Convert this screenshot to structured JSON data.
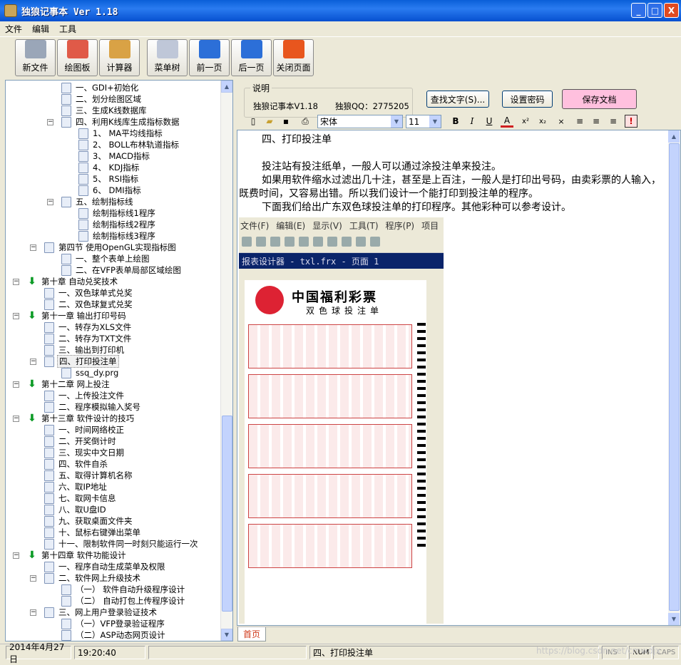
{
  "window": {
    "title": "独狼记事本 Ver 1.18",
    "controls": [
      "_",
      "□",
      "X"
    ]
  },
  "menu": [
    "文件",
    "编辑",
    "工具"
  ],
  "toolbar": [
    {
      "label": "新文件",
      "icon": "new-file-icon",
      "color": "#9aa6b8"
    },
    {
      "label": "绘图板",
      "icon": "paint-board-icon",
      "color": "#e05a48"
    },
    {
      "label": "计算器",
      "icon": "calculator-icon",
      "color": "#d9a245"
    },
    {
      "label": "菜单树",
      "icon": "menu-tree-icon",
      "color": "#bfc7d8"
    },
    {
      "label": "前一页",
      "icon": "arrow-left-icon",
      "color": "#2c6fd8"
    },
    {
      "label": "后一页",
      "icon": "arrow-right-icon",
      "color": "#2c6fd8"
    },
    {
      "label": "关闭页面",
      "icon": "close-page-icon",
      "color": "#e8561e"
    }
  ],
  "tree": [
    {
      "text": "一、GDI+初始化",
      "level": 4,
      "type": "doc"
    },
    {
      "text": "二、划分绘图区域",
      "level": 4,
      "type": "doc"
    },
    {
      "text": "三、生成K线数据库",
      "level": 4,
      "type": "doc"
    },
    {
      "text": "四、利用K线库生成指标数据",
      "level": 4,
      "type": "doc",
      "expanded": true
    },
    {
      "text": "1、 MA平均线指标",
      "level": 5,
      "type": "doc"
    },
    {
      "text": "2、 BOLL布林轨道指标",
      "level": 5,
      "type": "doc"
    },
    {
      "text": "3、 MACD指标",
      "level": 5,
      "type": "doc"
    },
    {
      "text": "4、 KDJ指标",
      "level": 5,
      "type": "doc"
    },
    {
      "text": "5、 RSI指标",
      "level": 5,
      "type": "doc"
    },
    {
      "text": "6、 DMI指标",
      "level": 5,
      "type": "doc"
    },
    {
      "text": "五、绘制指标线",
      "level": 4,
      "type": "doc",
      "expanded": true
    },
    {
      "text": "绘制指标线1程序",
      "level": 5,
      "type": "doc"
    },
    {
      "text": "绘制指标线2程序",
      "level": 5,
      "type": "doc"
    },
    {
      "text": "绘制指标线3程序",
      "level": 5,
      "type": "doc"
    },
    {
      "text": "第四节 使用OpenGL实现指标图",
      "level": 2,
      "type": "doc",
      "expanded": true
    },
    {
      "text": "一、整个表单上绘图",
      "level": 3,
      "type": "doc"
    },
    {
      "text": "二、在VFP表单局部区域绘图",
      "level": 3,
      "type": "doc"
    },
    {
      "text": "第十章 自动兑奖技术",
      "level": 1,
      "type": "chapter",
      "expanded": true
    },
    {
      "text": "一、双色球单式兑奖",
      "level": 2,
      "type": "doc"
    },
    {
      "text": "二、双色球复式兑奖",
      "level": 2,
      "type": "doc"
    },
    {
      "text": "第十一章 输出打印号码",
      "level": 1,
      "type": "chapter",
      "expanded": true
    },
    {
      "text": "一、转存为XLS文件",
      "level": 2,
      "type": "doc"
    },
    {
      "text": "二、转存为TXT文件",
      "level": 2,
      "type": "doc"
    },
    {
      "text": "三、输出到打印机",
      "level": 2,
      "type": "doc"
    },
    {
      "text": "四、打印投注单",
      "level": 2,
      "type": "doc",
      "expanded": true,
      "selected": true
    },
    {
      "text": "ssq_dy.prg",
      "level": 3,
      "type": "doc"
    },
    {
      "text": "第十二章 网上投注",
      "level": 1,
      "type": "chapter",
      "expanded": true
    },
    {
      "text": "一、上传投注文件",
      "level": 2,
      "type": "doc"
    },
    {
      "text": "二、程序模拟输入奖号",
      "level": 2,
      "type": "doc"
    },
    {
      "text": "第十三章 软件设计的技巧",
      "level": 1,
      "type": "chapter",
      "expanded": true
    },
    {
      "text": "一、时间网络校正",
      "level": 2,
      "type": "doc"
    },
    {
      "text": "二、开奖倒计时",
      "level": 2,
      "type": "doc"
    },
    {
      "text": "三、现实中文日期",
      "level": 2,
      "type": "doc"
    },
    {
      "text": "四、软件自杀",
      "level": 2,
      "type": "doc"
    },
    {
      "text": "五、取得计算机名称",
      "level": 2,
      "type": "doc"
    },
    {
      "text": "六、取IP地址",
      "level": 2,
      "type": "doc"
    },
    {
      "text": "七、取网卡信息",
      "level": 2,
      "type": "doc"
    },
    {
      "text": "八、取U盘ID",
      "level": 2,
      "type": "doc"
    },
    {
      "text": "九、获取桌面文件夹",
      "level": 2,
      "type": "doc"
    },
    {
      "text": "十、鼠标右键弹出菜单",
      "level": 2,
      "type": "doc"
    },
    {
      "text": "十一、限制软件同一时刻只能运行一次",
      "level": 2,
      "type": "doc"
    },
    {
      "text": "第十四章 软件功能设计",
      "level": 1,
      "type": "chapter",
      "expanded": true
    },
    {
      "text": "一、程序自动生成菜单及权限",
      "level": 2,
      "type": "doc"
    },
    {
      "text": "二、软件网上升级技术",
      "level": 2,
      "type": "doc",
      "expanded": true
    },
    {
      "text": "（一） 软件自动升级程序设计",
      "level": 3,
      "type": "doc"
    },
    {
      "text": "（二） 自动打包上传程序设计",
      "level": 3,
      "type": "doc"
    },
    {
      "text": "三、网上用户登录验证技术",
      "level": 2,
      "type": "doc",
      "expanded": true
    },
    {
      "text": "（一）VFP登录验证程序",
      "level": 3,
      "type": "doc"
    },
    {
      "text": "（二）ASP动态网页设计",
      "level": 3,
      "type": "doc"
    }
  ],
  "info": {
    "legend": "说明",
    "version": "独狼记事本V1.18",
    "qq": "独狼QQ：2775205"
  },
  "buttons": {
    "find": "查找文字(S)...",
    "password": "设置密码",
    "save": "保存文档"
  },
  "format": {
    "font": "宋体",
    "size": "11"
  },
  "document": {
    "heading": "四、打印投注单",
    "paragraphs": [
      "投注站有投注纸单，一般人可以通过涂投注单来投注。",
      "如果用软件缩水过滤出几十注，甚至是上百注，一般人是打印出号码，由卖彩票的人输入，既费时间，又容易出错。所以我们设计一个能打印到投注单的程序。",
      "下面我们给出广东双色球投注单的打印程序。其他彩种可以参考设计。"
    ]
  },
  "embedded": {
    "menu": [
      "文件(F)",
      "编辑(E)",
      "显示(V)",
      "工具(T)",
      "程序(P)",
      "项目"
    ],
    "window_title": "报表设计器 - txl.frx - 页面 1",
    "brand": "中国福利彩票",
    "subtitle": "双色球投注单"
  },
  "tabs": [
    "首页"
  ],
  "status": {
    "date": "2014年4月27日",
    "time": "19:20:40",
    "doc": "四、打印投注单",
    "ins": "INS",
    "num": "NUM",
    "caps": "CAPS"
  },
  "watermark": "https://blog.csdn.net/cmwdjx"
}
